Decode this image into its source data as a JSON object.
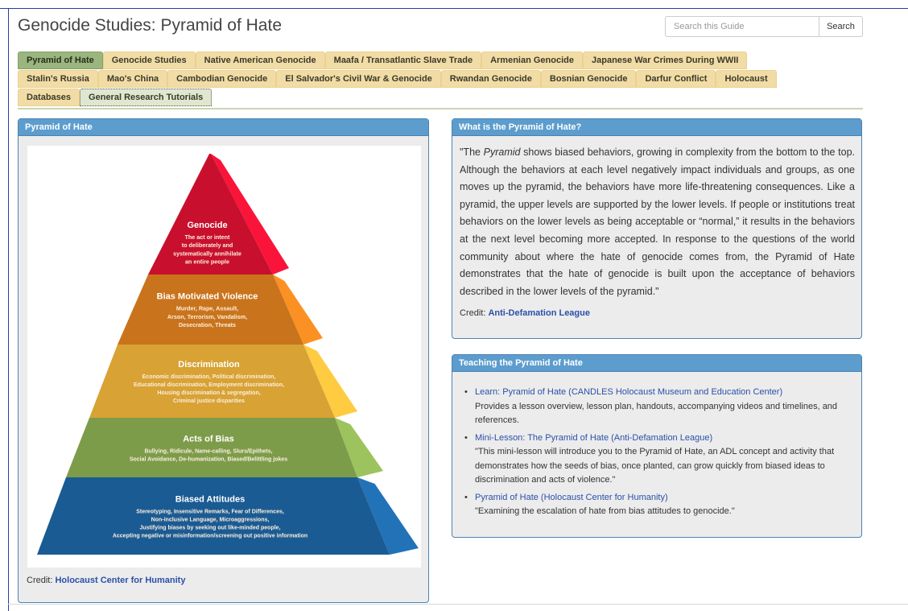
{
  "header": {
    "title": "Genocide Studies: Pyramid of Hate",
    "search_placeholder": "Search this Guide",
    "search_button": "Search"
  },
  "tabs": {
    "row1": [
      "Pyramid of Hate",
      "Genocide Studies",
      "Native American Genocide",
      "Maafa / Transatlantic Slave Trade",
      "Armenian Genocide",
      "Japanese War Crimes During WWII"
    ],
    "row2": [
      "Stalin's Russia",
      "Mao's China",
      "Cambodian Genocide",
      "El Salvador's Civil War & Genocide",
      "Rwandan Genocide",
      "Bosnian Genocide",
      "Darfur Conflict",
      "Holocaust"
    ],
    "row3": [
      "Databases",
      "General Research Tutorials"
    ]
  },
  "pyramid_panel": {
    "title": "Pyramid of Hate",
    "credit_label": "Credit:",
    "credit_link": "Holocaust Center for Humanity",
    "levels": [
      {
        "title": "Genocide",
        "color": "#c8102e",
        "lines": [
          "The act or intent",
          "to deliberately and",
          "systematically annihilate",
          "an entire people"
        ]
      },
      {
        "title": "Bias Motivated Violence",
        "color": "#c9741c",
        "lines": [
          "Murder, Rape, Assault,",
          "Arson, Terrorism, Vandalism,",
          "Desecration, Threats"
        ]
      },
      {
        "title": "Discrimination",
        "color": "#d8a234",
        "lines": [
          "Economic discrimination, Political discrimination,",
          "Educational discrimination, Employment discrimination,",
          "Housing discrimination & segregation,",
          "Criminal justice disparities"
        ]
      },
      {
        "title": "Acts of Bias",
        "color": "#7d9c4a",
        "lines": [
          "Bullying, Ridicule, Name-calling, Slurs/Epithets,",
          "Social Avoidance, De-humanization, Biased/Belittling jokes"
        ]
      },
      {
        "title": "Biased Attitudes",
        "color": "#1b5b93",
        "lines": [
          "Stereotyping, Insensitive Remarks, Fear of Differences,",
          "Non-inclusive Language, Microaggressions,",
          "Justifying biases by seeking out like-minded people,",
          "Accepting negative or misinformation/screening out positive information"
        ]
      }
    ]
  },
  "what_panel": {
    "title": "What is the Pyramid of Hate?",
    "quote_open": "\"The ",
    "quote_italic": "Pyramid",
    "quote_rest": " shows biased behaviors, growing in complexity from the bottom to the top. Although the behaviors at each level negatively impact individuals and groups, as one moves up the pyramid, the behaviors have more life-threatening consequences. Like a pyramid, the upper levels are supported by the lower levels. If people or institutions treat behaviors on the lower levels as being acceptable or “normal,” it results in the behaviors at the next level becoming more accepted. In response to the questions of the world community about where the hate of genocide comes from, the Pyramid of Hate demonstrates that the hate of genocide is built upon the acceptance of behaviors described in the lower levels of the pyramid.\"",
    "credit_label": "Credit:",
    "credit_link": "Anti-Defamation League"
  },
  "teaching_panel": {
    "title": "Teaching the Pyramid of Hate",
    "items": [
      {
        "link": "Learn: Pyramid of Hate (CANDLES Holocaust Museum and Education Center)",
        "desc": "Provides a lesson overview, lesson plan, handouts, accompanying videos and timelines, and references."
      },
      {
        "link": "Mini-Lesson: The Pyramid of Hate (Anti-Defamation League)",
        "desc": "\"This mini-lesson will introduce you to the Pyramid of Hate, an ADL concept and activity that demonstrates how the seeds of bias, once planted, can grow quickly from biased ideas to discrimination and acts of violence.\""
      },
      {
        "link": "Pyramid of Hate (Holocaust Center for Humanity)",
        "desc": "\"Examining the escalation of hate from bias attitudes to genocide.\""
      }
    ]
  }
}
